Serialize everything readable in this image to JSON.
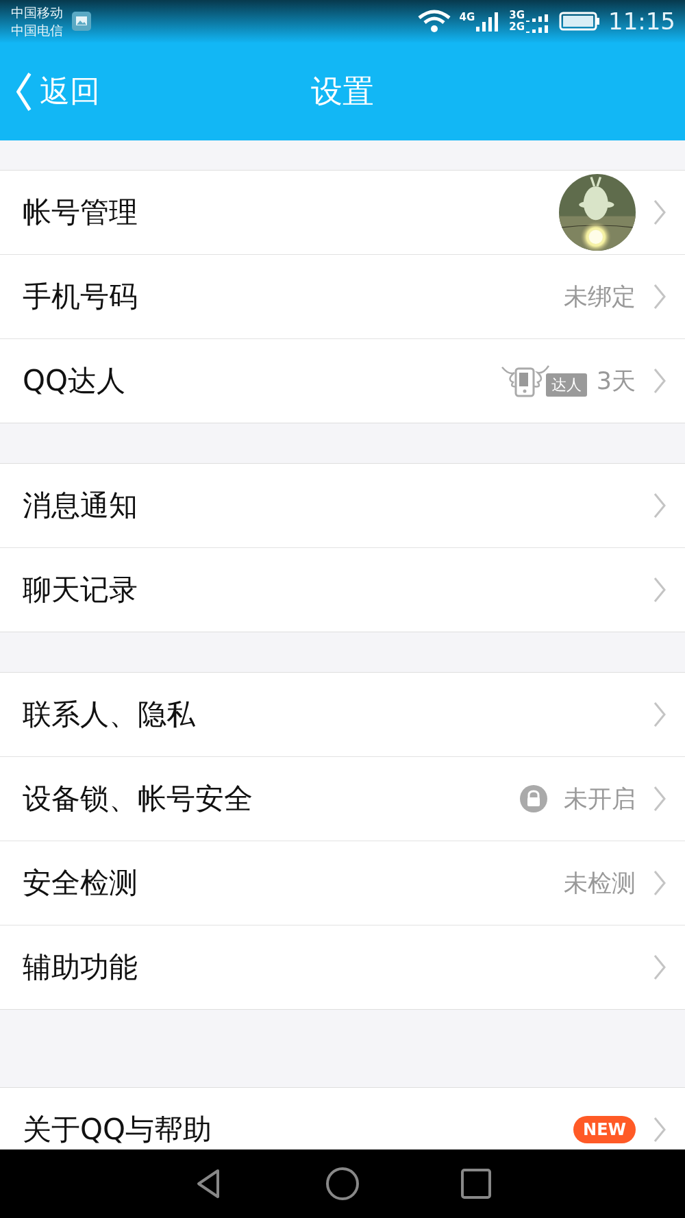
{
  "status_bar": {
    "carriers": [
      "中国移动",
      "中国电信"
    ],
    "network_labels": [
      "4G",
      "3G",
      "2G"
    ],
    "time": "11:15"
  },
  "header": {
    "back": "返回",
    "title": "设置"
  },
  "sections": [
    {
      "rows": [
        {
          "label": "帐号管理",
          "kind": "avatar"
        },
        {
          "label": "手机号码",
          "kind": "value",
          "value": "未绑定"
        },
        {
          "label": "QQ达人",
          "kind": "talent",
          "badge": "达人",
          "value": "3天"
        }
      ]
    },
    {
      "rows": [
        {
          "label": "消息通知",
          "kind": "plain"
        },
        {
          "label": "聊天记录",
          "kind": "plain"
        }
      ]
    },
    {
      "rows": [
        {
          "label": "联系人、隐私",
          "kind": "plain"
        },
        {
          "label": "设备锁、帐号安全",
          "kind": "lock",
          "value": "未开启"
        },
        {
          "label": "安全检测",
          "kind": "value",
          "value": "未检测"
        },
        {
          "label": "辅助功能",
          "kind": "plain"
        }
      ]
    },
    {
      "rows": [
        {
          "label": "关于QQ与帮助",
          "kind": "new",
          "badge": "NEW"
        }
      ]
    }
  ]
}
